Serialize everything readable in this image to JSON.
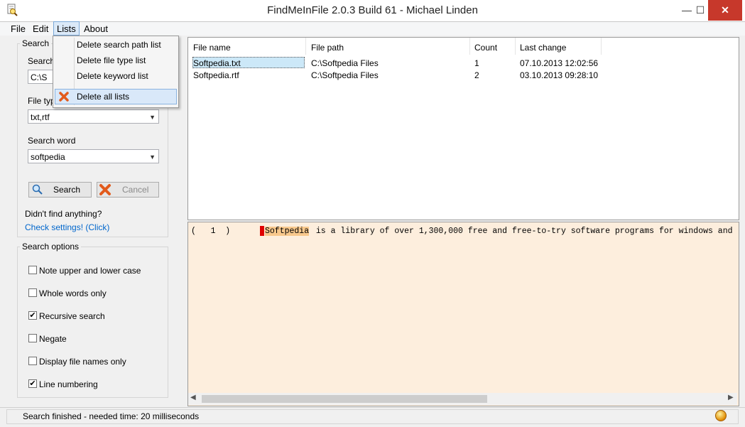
{
  "window": {
    "title": "FindMeInFile 2.0.3 Build 61 - Michael Linden",
    "minimize": "—",
    "maximize": "☐",
    "close": "✕"
  },
  "menu": {
    "file": "File",
    "edit": "Edit",
    "lists": "Lists",
    "about": "About"
  },
  "lists_menu": {
    "items": [
      "Delete search path list",
      "Delete file type list",
      "Delete keyword list",
      "Delete all lists"
    ]
  },
  "search_group": {
    "title": "Search",
    "path_label": "Search",
    "path_value": "C:\\S",
    "filetype_label": "File typ",
    "filetype_value": "txt,rtf",
    "word_label": "Search word",
    "word_value": "softpedia",
    "search_button": "Search",
    "cancel_button": "Cancel",
    "hint": "Didn't find anything?",
    "settings_link": "Check settings! (Click)"
  },
  "options_group": {
    "title": "Search options",
    "options": [
      {
        "label": "Note upper and lower case",
        "checked": false
      },
      {
        "label": "Whole words only",
        "checked": false
      },
      {
        "label": "Recursive search",
        "checked": true
      },
      {
        "label": "Negate",
        "checked": false
      },
      {
        "label": "Display file names only",
        "checked": false
      },
      {
        "label": "Line numbering",
        "checked": true
      }
    ]
  },
  "results": {
    "columns": [
      "File name",
      "File path",
      "Count",
      "Last change"
    ],
    "rows": [
      [
        "Softpedia.txt",
        "C:\\Softpedia Files",
        "1",
        "07.10.2013 12:02:56"
      ],
      [
        "Softpedia.rtf",
        "C:\\Softpedia Files",
        "2",
        "03.10.2013 09:28:10"
      ]
    ]
  },
  "preview": {
    "line_prefix": "(   1  )",
    "highlight": "Softpedia",
    "rest": " is a library of over 1,300,000 free and free-to-try software programs for windows and"
  },
  "status": {
    "text": "Search finished - needed time: 20 milliseconds"
  },
  "colors": {
    "accent_link": "#0066cc",
    "preview_bg": "#fdeedd",
    "highlight_bg": "#f8c88c",
    "line_marker": "#e00000"
  }
}
